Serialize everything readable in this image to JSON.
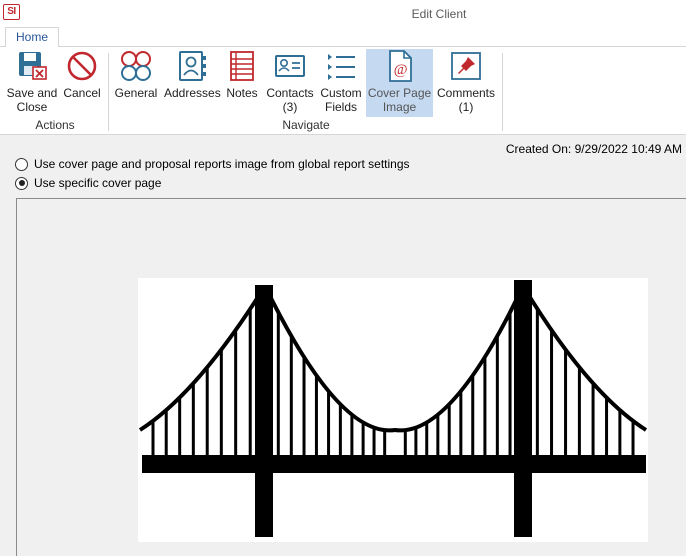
{
  "window": {
    "logo_text": "SI",
    "title": "Edit Client"
  },
  "tabs": [
    {
      "label": "Home",
      "active": true
    }
  ],
  "ribbon": {
    "actions_group_label": "Actions",
    "navigate_group_label": "Navigate",
    "buttons": {
      "save_and_close": {
        "line1": "Save and",
        "line2": "Close",
        "icon": "save-icon"
      },
      "cancel": {
        "line1": "Cancel",
        "icon": "cancel-icon"
      },
      "general": {
        "line1": "General",
        "icon": "general-icon"
      },
      "addresses": {
        "line1": "Addresses",
        "icon": "address-book-icon"
      },
      "notes": {
        "line1": "Notes",
        "icon": "notes-icon"
      },
      "contacts": {
        "line1": "Contacts",
        "line2": "(3)",
        "icon": "contact-card-icon"
      },
      "custom_fields": {
        "line1": "Custom",
        "line2": "Fields",
        "icon": "list-icon"
      },
      "cover_page_image": {
        "line1": "Cover Page",
        "line2": "Image",
        "icon": "document-at-icon",
        "active": true
      },
      "comments": {
        "line1": "Comments",
        "line2": "(1)",
        "icon": "pushpin-icon"
      }
    }
  },
  "content": {
    "created_on": "Created On: 9/29/2022 10:49 AM",
    "options": [
      {
        "label": "Use cover page and proposal reports image from global report settings",
        "checked": false
      },
      {
        "label": "Use specific cover page",
        "checked": true
      }
    ],
    "cover_image": {
      "subject": "suspension-bridge-icon"
    }
  },
  "colors": {
    "accent": "#2b579a",
    "logo": "#c0282d",
    "active_button_bg": "#c5d9f1",
    "icon_blue": "#2f6f96",
    "icon_red": "#c0282d"
  }
}
